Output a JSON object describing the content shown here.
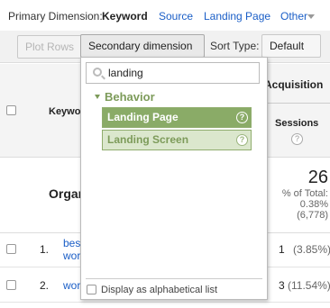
{
  "primary_dimension": {
    "label": "Primary Dimension:",
    "active": "Keyword",
    "links": [
      "Source",
      "Landing Page",
      "Other"
    ]
  },
  "toolbar": {
    "plot_rows": "Plot Rows",
    "secondary_dimension": "Secondary dimension",
    "sort_type_label": "Sort Type:",
    "sort_type_value": "Default"
  },
  "table": {
    "keyword_header": "Keyword",
    "acquisition_header": "Acquisition",
    "sessions_header": "Sessions",
    "org_label": "Organic",
    "total_sessions": "26",
    "pct_of_total_label": "% of Total:",
    "pct_of_total_value": "0.38%",
    "pct_of_total_count": "(6,778)",
    "rows": [
      {
        "num": "1.",
        "keyword_line1": "bes",
        "keyword_line2": "wor",
        "sessions": "1",
        "pct": "(3.85%)"
      },
      {
        "num": "2.",
        "keyword_line1": "wor",
        "sessions": "3",
        "pct": "(11.54%)"
      }
    ]
  },
  "dropdown": {
    "search_value": "landing",
    "group": "Behavior",
    "options": [
      "Landing Page",
      "Landing Screen"
    ],
    "alphabetical_label": "Display as alphabetical list"
  },
  "colors": {
    "link": "#1a5ec7",
    "option_selected": "#8aab67",
    "option_alt": "#dbe7cd",
    "group_text": "#7d9b5a"
  }
}
